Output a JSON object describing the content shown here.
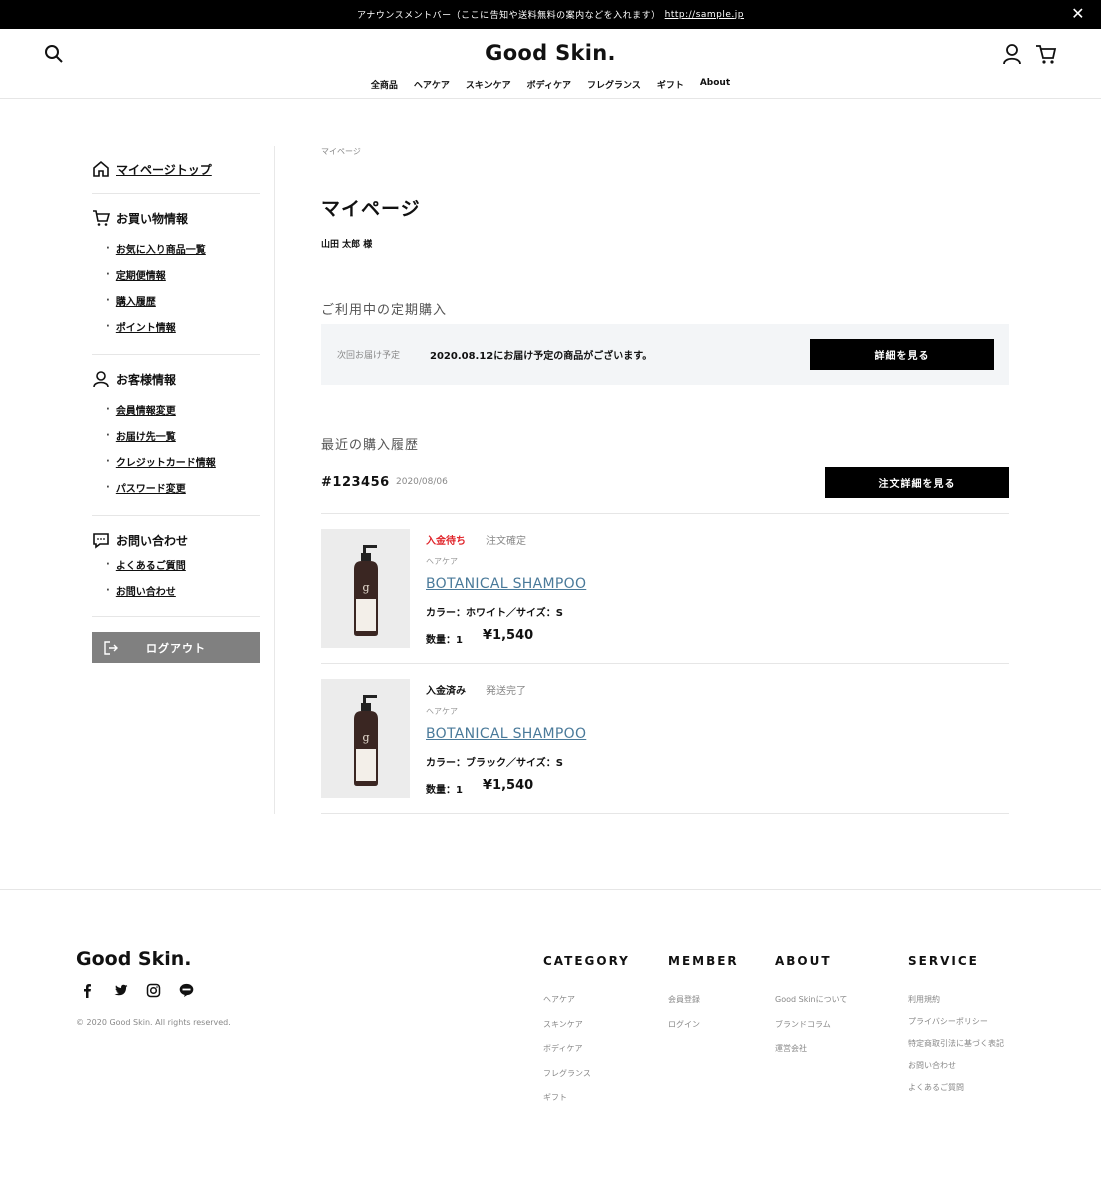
{
  "announcement": {
    "text": "アナウンスメントバー（ここに告知や送料無料の案内などを入れます）",
    "link": "http://sample.jp",
    "close": "✕"
  },
  "header": {
    "logo": "Good Skin.",
    "nav": [
      "全商品",
      "ヘアケア",
      "スキンケア",
      "ボディケア",
      "フレグランス",
      "ギフト",
      "About"
    ]
  },
  "sidebar": {
    "top_link": "マイページトップ",
    "shopping": {
      "title": "お買い物情報",
      "items": [
        "お気に入り商品一覧",
        "定期便情報",
        "購入履歴",
        "ポイント情報"
      ]
    },
    "customer": {
      "title": "お客様情報",
      "items": [
        "会員情報変更",
        "お届け先一覧",
        "クレジットカード情報",
        "パスワード変更"
      ]
    },
    "contact": {
      "title": "お問い合わせ",
      "items": [
        "よくあるご質問",
        "お問い合わせ"
      ]
    },
    "logout": "ログアウト"
  },
  "main": {
    "breadcrumb": "マイページ",
    "title": "マイページ",
    "user_name": "山田 太郎 様",
    "subscription": {
      "section_title": "ご利用中の定期購入",
      "label": "次回お届け予定",
      "message": "2020.08.12にお届け予定の商品がございます。",
      "button": "詳細を見る"
    },
    "history": {
      "section_title": "最近の購入履歴",
      "order_number": "#123456",
      "order_date": "2020/08/06",
      "button": "注文詳細を見る",
      "items": [
        {
          "status": "入金待ち",
          "status_color": "#e0242a",
          "shipping": "注文確定",
          "category": "ヘアケア",
          "name": "BOTANICAL SHAMPOO",
          "variant": "カラー：ホワイト／サイズ：S",
          "qty": "数量：1",
          "price": "¥1,540"
        },
        {
          "status": "入金済み",
          "status_color": "#111111",
          "shipping": "発送完了",
          "category": "ヘアケア",
          "name": "BOTANICAL SHAMPOO",
          "variant": "カラー：ブラック／サイズ：S",
          "qty": "数量：1",
          "price": "¥1,540"
        }
      ]
    }
  },
  "footer": {
    "logo": "Good Skin.",
    "copyright": "© 2020 Good Skin. All rights reserved.",
    "social": [
      "facebook-icon",
      "twitter-icon",
      "instagram-icon",
      "line-icon"
    ],
    "columns": [
      {
        "title": "CATEGORY",
        "items": [
          "ヘアケア",
          "スキンケア",
          "ボディケア",
          "フレグランス",
          "ギフト"
        ]
      },
      {
        "title": "MEMBER",
        "items": [
          "会員登録",
          "ログイン"
        ]
      },
      {
        "title": "ABOUT",
        "items": [
          "Good Skinについて",
          "ブランドコラム",
          "運営会社"
        ]
      },
      {
        "title": "SERVICE",
        "items": [
          "利用規約",
          "プライバシーポリシー",
          "特定商取引法に基づく表記",
          "お問い合わせ",
          "よくあるご質問"
        ]
      }
    ]
  }
}
